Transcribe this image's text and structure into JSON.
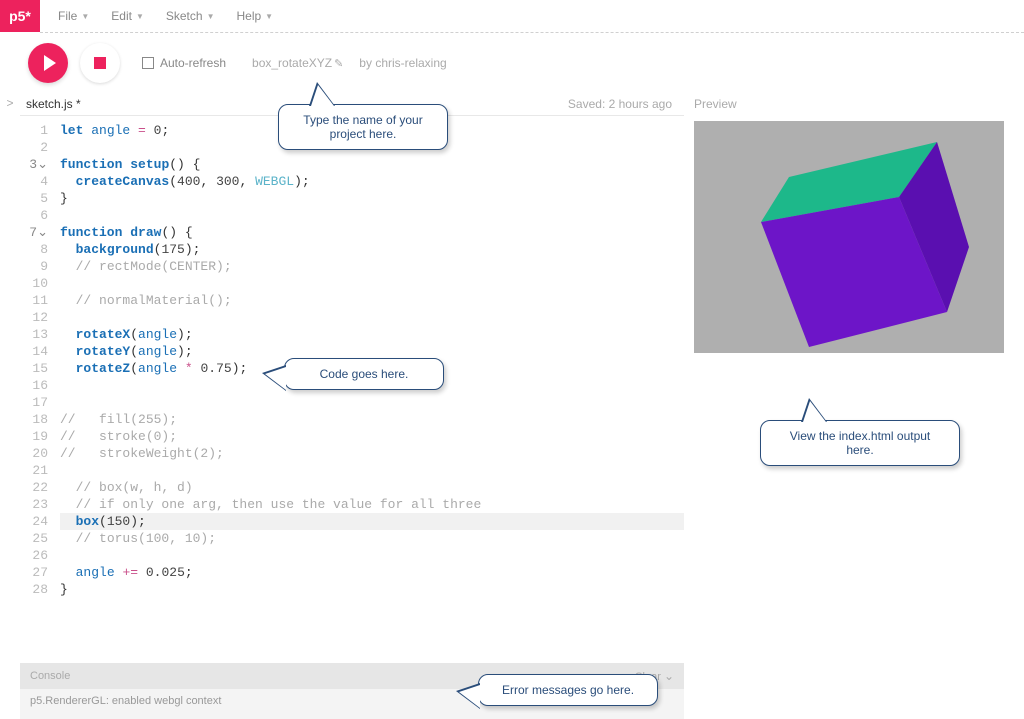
{
  "logo": "p5*",
  "menu": {
    "file": "File",
    "edit": "Edit",
    "sketch": "Sketch",
    "help": "Help"
  },
  "toolbar": {
    "autorefresh_label": "Auto-refresh",
    "project_name": "box_rotateXYZ",
    "author_prefix": "by",
    "author": "chris-relaxing"
  },
  "tabs": {
    "sketch_file": "sketch.js",
    "modified_marker": "*",
    "saved": "Saved: 2 hours ago"
  },
  "sidebar_toggle": ">",
  "code_lines": [
    {
      "n": 1,
      "fold": false,
      "html": "<span class='kw'>let</span> <span class='id'>angle</span> <span class='op'>=</span> <span class='num'>0</span>;"
    },
    {
      "n": 2,
      "fold": false,
      "html": ""
    },
    {
      "n": 3,
      "fold": true,
      "html": "<span class='kw'>function</span> <span class='fn'>setup</span>() {"
    },
    {
      "n": 4,
      "fold": false,
      "html": "  <span class='fn'>createCanvas</span>(<span class='num'>400</span>, <span class='num'>300</span>, <span class='webgl'>WEBGL</span>);"
    },
    {
      "n": 5,
      "fold": false,
      "html": "}"
    },
    {
      "n": 6,
      "fold": false,
      "html": ""
    },
    {
      "n": 7,
      "fold": true,
      "html": "<span class='kw'>function</span> <span class='fn'>draw</span>() {"
    },
    {
      "n": 8,
      "fold": false,
      "html": "  <span class='fn'>background</span>(<span class='num'>175</span>);"
    },
    {
      "n": 9,
      "fold": false,
      "html": "  <span class='cm'>// rectMode(CENTER);</span>"
    },
    {
      "n": 10,
      "fold": false,
      "html": ""
    },
    {
      "n": 11,
      "fold": false,
      "html": "  <span class='cm'>// normalMaterial();</span>"
    },
    {
      "n": 12,
      "fold": false,
      "html": ""
    },
    {
      "n": 13,
      "fold": false,
      "html": "  <span class='fn'>rotateX</span>(<span class='id'>angle</span>);"
    },
    {
      "n": 14,
      "fold": false,
      "html": "  <span class='fn'>rotateY</span>(<span class='id'>angle</span>);"
    },
    {
      "n": 15,
      "fold": false,
      "html": "  <span class='fn'>rotateZ</span>(<span class='id'>angle</span> <span class='op'>*</span> <span class='num'>0.75</span>);"
    },
    {
      "n": 16,
      "fold": false,
      "html": ""
    },
    {
      "n": 17,
      "fold": false,
      "html": ""
    },
    {
      "n": 18,
      "fold": false,
      "html": "<span class='cm'>//   fill(255);</span>"
    },
    {
      "n": 19,
      "fold": false,
      "html": "<span class='cm'>//   stroke(0);</span>"
    },
    {
      "n": 20,
      "fold": false,
      "html": "<span class='cm'>//   strokeWeight(2);</span>"
    },
    {
      "n": 21,
      "fold": false,
      "html": ""
    },
    {
      "n": 22,
      "fold": false,
      "html": "  <span class='cm'>// box(w, h, d)</span>"
    },
    {
      "n": 23,
      "fold": false,
      "html": "  <span class='cm'>// if only one arg, then use the value for all three</span>"
    },
    {
      "n": 24,
      "fold": false,
      "hl": true,
      "html": "  <span class='fn'>box</span>(<span class='num'>150</span>);"
    },
    {
      "n": 25,
      "fold": false,
      "html": "  <span class='cm'>// torus(100, 10);</span>"
    },
    {
      "n": 26,
      "fold": false,
      "html": ""
    },
    {
      "n": 27,
      "fold": false,
      "html": "  <span class='id'>angle</span> <span class='op'>+=</span> <span class='num'>0.025</span>;"
    },
    {
      "n": 28,
      "fold": false,
      "html": "}"
    }
  ],
  "console": {
    "header": "Console",
    "clear": "Clear",
    "message": "p5.RendererGL: enabled webgl context"
  },
  "preview": {
    "label": "Preview"
  },
  "callouts": {
    "project": "Type the name of your project here.",
    "code": "Code goes here.",
    "preview": "View the index.html output here.",
    "console": "Error messages go here."
  }
}
